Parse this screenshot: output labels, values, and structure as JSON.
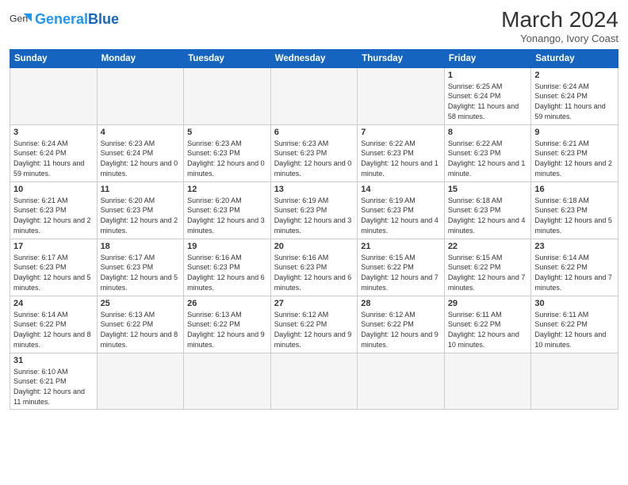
{
  "header": {
    "logo_general": "General",
    "logo_blue": "Blue",
    "month_title": "March 2024",
    "subtitle": "Yonango, Ivory Coast"
  },
  "days_of_week": [
    "Sunday",
    "Monday",
    "Tuesday",
    "Wednesday",
    "Thursday",
    "Friday",
    "Saturday"
  ],
  "weeks": [
    [
      {
        "date": "",
        "info": ""
      },
      {
        "date": "",
        "info": ""
      },
      {
        "date": "",
        "info": ""
      },
      {
        "date": "",
        "info": ""
      },
      {
        "date": "",
        "info": ""
      },
      {
        "date": "1",
        "info": "Sunrise: 6:25 AM\nSunset: 6:24 PM\nDaylight: 11 hours\nand 58 minutes."
      },
      {
        "date": "2",
        "info": "Sunrise: 6:24 AM\nSunset: 6:24 PM\nDaylight: 11 hours\nand 59 minutes."
      }
    ],
    [
      {
        "date": "3",
        "info": "Sunrise: 6:24 AM\nSunset: 6:24 PM\nDaylight: 11 hours\nand 59 minutes."
      },
      {
        "date": "4",
        "info": "Sunrise: 6:23 AM\nSunset: 6:24 PM\nDaylight: 12 hours\nand 0 minutes."
      },
      {
        "date": "5",
        "info": "Sunrise: 6:23 AM\nSunset: 6:23 PM\nDaylight: 12 hours\nand 0 minutes."
      },
      {
        "date": "6",
        "info": "Sunrise: 6:23 AM\nSunset: 6:23 PM\nDaylight: 12 hours\nand 0 minutes."
      },
      {
        "date": "7",
        "info": "Sunrise: 6:22 AM\nSunset: 6:23 PM\nDaylight: 12 hours\nand 1 minute."
      },
      {
        "date": "8",
        "info": "Sunrise: 6:22 AM\nSunset: 6:23 PM\nDaylight: 12 hours\nand 1 minute."
      },
      {
        "date": "9",
        "info": "Sunrise: 6:21 AM\nSunset: 6:23 PM\nDaylight: 12 hours\nand 2 minutes."
      }
    ],
    [
      {
        "date": "10",
        "info": "Sunrise: 6:21 AM\nSunset: 6:23 PM\nDaylight: 12 hours\nand 2 minutes."
      },
      {
        "date": "11",
        "info": "Sunrise: 6:20 AM\nSunset: 6:23 PM\nDaylight: 12 hours\nand 2 minutes."
      },
      {
        "date": "12",
        "info": "Sunrise: 6:20 AM\nSunset: 6:23 PM\nDaylight: 12 hours\nand 3 minutes."
      },
      {
        "date": "13",
        "info": "Sunrise: 6:19 AM\nSunset: 6:23 PM\nDaylight: 12 hours\nand 3 minutes."
      },
      {
        "date": "14",
        "info": "Sunrise: 6:19 AM\nSunset: 6:23 PM\nDaylight: 12 hours\nand 4 minutes."
      },
      {
        "date": "15",
        "info": "Sunrise: 6:18 AM\nSunset: 6:23 PM\nDaylight: 12 hours\nand 4 minutes."
      },
      {
        "date": "16",
        "info": "Sunrise: 6:18 AM\nSunset: 6:23 PM\nDaylight: 12 hours\nand 5 minutes."
      }
    ],
    [
      {
        "date": "17",
        "info": "Sunrise: 6:17 AM\nSunset: 6:23 PM\nDaylight: 12 hours\nand 5 minutes."
      },
      {
        "date": "18",
        "info": "Sunrise: 6:17 AM\nSunset: 6:23 PM\nDaylight: 12 hours\nand 5 minutes."
      },
      {
        "date": "19",
        "info": "Sunrise: 6:16 AM\nSunset: 6:23 PM\nDaylight: 12 hours\nand 6 minutes."
      },
      {
        "date": "20",
        "info": "Sunrise: 6:16 AM\nSunset: 6:23 PM\nDaylight: 12 hours\nand 6 minutes."
      },
      {
        "date": "21",
        "info": "Sunrise: 6:15 AM\nSunset: 6:22 PM\nDaylight: 12 hours\nand 7 minutes."
      },
      {
        "date": "22",
        "info": "Sunrise: 6:15 AM\nSunset: 6:22 PM\nDaylight: 12 hours\nand 7 minutes."
      },
      {
        "date": "23",
        "info": "Sunrise: 6:14 AM\nSunset: 6:22 PM\nDaylight: 12 hours\nand 7 minutes."
      }
    ],
    [
      {
        "date": "24",
        "info": "Sunrise: 6:14 AM\nSunset: 6:22 PM\nDaylight: 12 hours\nand 8 minutes."
      },
      {
        "date": "25",
        "info": "Sunrise: 6:13 AM\nSunset: 6:22 PM\nDaylight: 12 hours\nand 8 minutes."
      },
      {
        "date": "26",
        "info": "Sunrise: 6:13 AM\nSunset: 6:22 PM\nDaylight: 12 hours\nand 9 minutes."
      },
      {
        "date": "27",
        "info": "Sunrise: 6:12 AM\nSunset: 6:22 PM\nDaylight: 12 hours\nand 9 minutes."
      },
      {
        "date": "28",
        "info": "Sunrise: 6:12 AM\nSunset: 6:22 PM\nDaylight: 12 hours\nand 9 minutes."
      },
      {
        "date": "29",
        "info": "Sunrise: 6:11 AM\nSunset: 6:22 PM\nDaylight: 12 hours\nand 10 minutes."
      },
      {
        "date": "30",
        "info": "Sunrise: 6:11 AM\nSunset: 6:22 PM\nDaylight: 12 hours\nand 10 minutes."
      }
    ],
    [
      {
        "date": "31",
        "info": "Sunrise: 6:10 AM\nSunset: 6:21 PM\nDaylight: 12 hours\nand 11 minutes."
      },
      {
        "date": "",
        "info": ""
      },
      {
        "date": "",
        "info": ""
      },
      {
        "date": "",
        "info": ""
      },
      {
        "date": "",
        "info": ""
      },
      {
        "date": "",
        "info": ""
      },
      {
        "date": "",
        "info": ""
      }
    ]
  ]
}
